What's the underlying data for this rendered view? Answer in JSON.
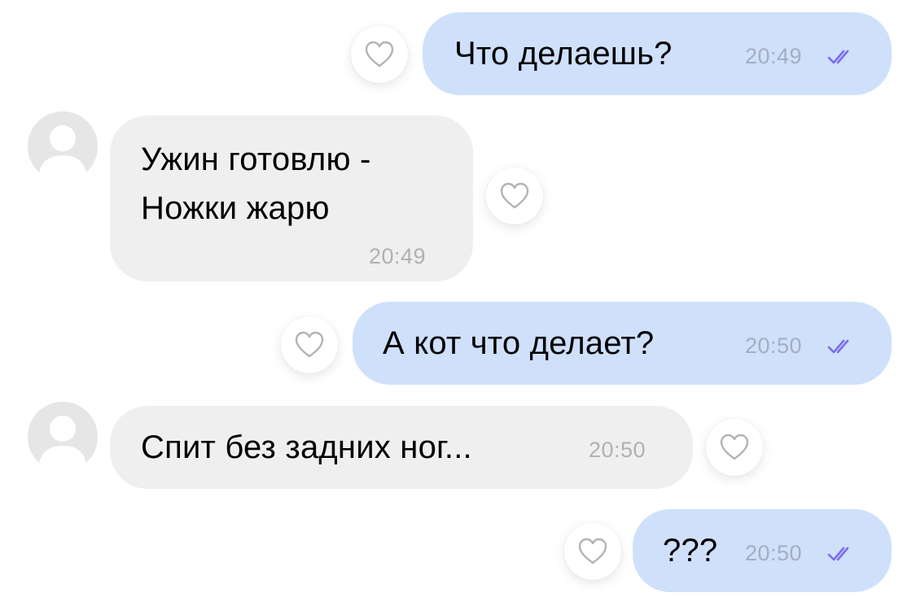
{
  "conversation": {
    "messages": [
      {
        "direction": "outgoing",
        "text": "Что делаешь?",
        "time": "20:49",
        "status": "read"
      },
      {
        "direction": "incoming",
        "text_line1": "Ужин готовлю -",
        "text_line2": "Ножки жарю",
        "time": "20:49"
      },
      {
        "direction": "outgoing",
        "text": "А кот что делает?",
        "time": "20:50",
        "status": "read"
      },
      {
        "direction": "incoming",
        "text": "Спит без задних ног...",
        "time": "20:50"
      },
      {
        "direction": "outgoing",
        "text": "???",
        "time": "20:50",
        "status": "read"
      }
    ]
  },
  "colors": {
    "outgoing_bubble": "#cfe0fb",
    "incoming_bubble": "#efefef",
    "read_checkmarks": "#7b6cf0",
    "timestamp": "#b1b1b1"
  },
  "icons": {
    "reaction": "heart-outline-icon",
    "read_status": "double-check-icon",
    "avatar": "default-avatar-icon"
  }
}
